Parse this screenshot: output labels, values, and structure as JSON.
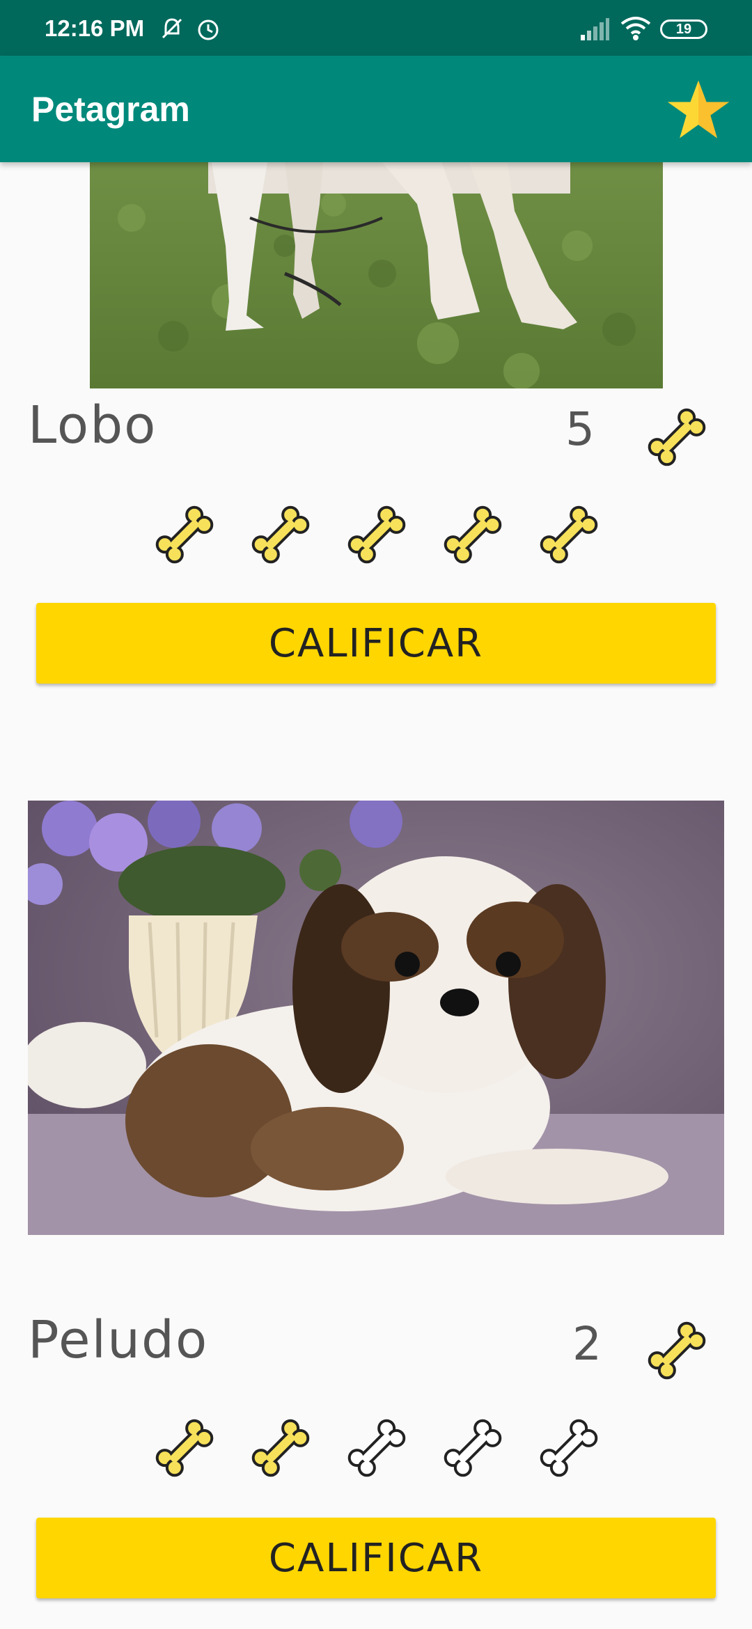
{
  "status_bar": {
    "time": "12:16 PM",
    "battery": "19",
    "icons": [
      "notifications-off-icon",
      "alarm-icon",
      "signal-icon",
      "wifi-icon",
      "battery-icon"
    ]
  },
  "app_bar": {
    "title": "Petagram",
    "action_icon": "star-icon",
    "colors": {
      "primary": "#00897b",
      "primary_dark": "#00695c",
      "star": "#fdd835"
    }
  },
  "pets": [
    {
      "name": "Lobo",
      "rating_count": "5",
      "bones_filled": 5,
      "bones_total": 5,
      "button_label": "CALIFICAR",
      "photo": "husky-legs-on-grass"
    },
    {
      "name": "Peludo",
      "rating_count": "2",
      "bones_filled": 2,
      "bones_total": 5,
      "button_label": "CALIFICAR",
      "photo": "shih-tzu-with-flowers"
    }
  ],
  "accent_colors": {
    "button": "#ffd600",
    "bone": "#f7e15a"
  }
}
